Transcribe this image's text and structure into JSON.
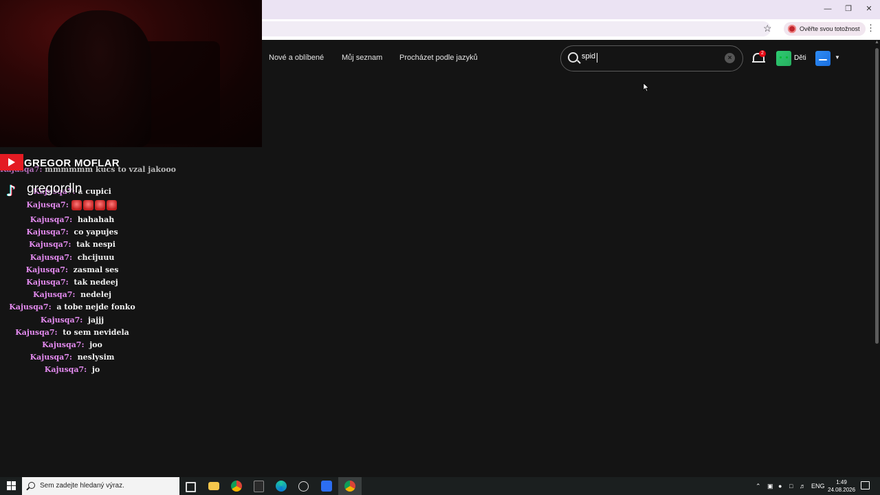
{
  "browser": {
    "verify_label": "Ověřte svou totožnost",
    "window_controls": [
      "minimize-icon",
      "restore-icon",
      "close-icon"
    ]
  },
  "nav": {
    "links": [
      "Nové a oblíbené",
      "Můj seznam",
      "Procházet podle jazyků"
    ]
  },
  "search": {
    "value": "spid"
  },
  "notifications": {
    "count": "2"
  },
  "profiles": {
    "kids_label": "Děti"
  },
  "stream": {
    "youtube_name": "GREGOR MOFLAR",
    "tiktok_name": "gregordln"
  },
  "chat": {
    "partial_lines": [
      {
        "user": "Kajusqa7:",
        "msg": "mmmmmm kucs to vzal jakooo"
      },
      {
        "user": "Kajusqa7:",
        "msg": "a cupici"
      }
    ],
    "emote_user": "Kajusqa7:",
    "emote_count": 4,
    "messages": [
      {
        "user": "Kajusqa7:",
        "msg": "hahahah"
      },
      {
        "user": "Kajusqa7:",
        "msg": "co yapujes"
      },
      {
        "user": "Kajusqa7:",
        "msg": "tak nespi"
      },
      {
        "user": "Kajusqa7:",
        "msg": "chcijuuu"
      },
      {
        "user": "Kajusqa7:",
        "msg": "zasmal ses"
      },
      {
        "user": "Kajusqa7:",
        "msg": "tak nedeej"
      },
      {
        "user": "Kajusqa7:",
        "msg": "nedelej"
      },
      {
        "user": "Kajusqa7:",
        "msg": "a tobe nejde fonko"
      },
      {
        "user": "Kajusqa7:",
        "msg": "jajjj"
      },
      {
        "user": "Kajusqa7:",
        "msg": "to sem nevidela"
      },
      {
        "user": "Kajusqa7:",
        "msg": "joo"
      },
      {
        "user": "Kajusqa7:",
        "msg": "neslysim"
      },
      {
        "user": "Kajusqa7:",
        "msg": "jo"
      }
    ]
  },
  "taskbar": {
    "search_placeholder": "Sem zadejte hledaný výraz.",
    "language": "ENG",
    "time": "1:49",
    "date": "24.08.2026",
    "apps": [
      "task-view-icon",
      "file-explorer-icon",
      "chrome-icon",
      "epic-games-icon",
      "edge-icon",
      "steam-icon",
      "roblox-icon",
      "chrome-active-icon"
    ]
  },
  "colors": {
    "background": "#141414",
    "accent_red": "#e50914",
    "chat_user": "#e48bf0",
    "youtube_red": "#e41b23"
  }
}
